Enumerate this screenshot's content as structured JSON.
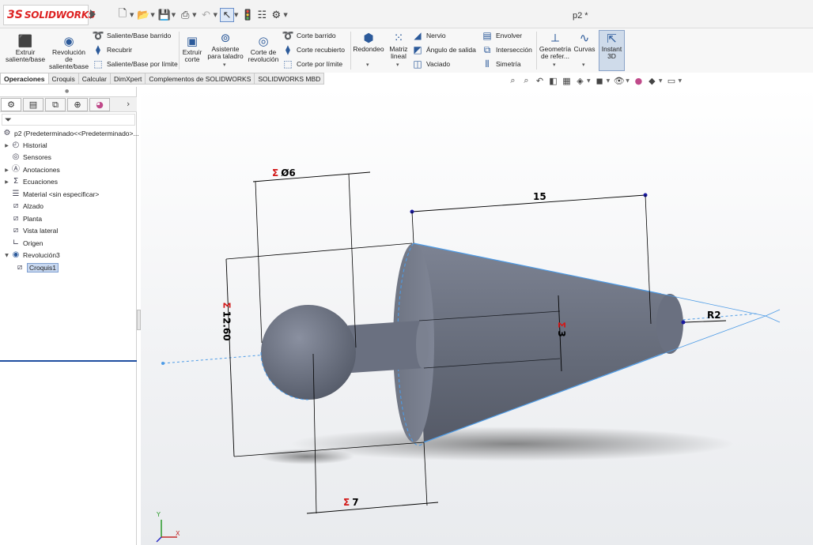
{
  "app": {
    "logo_mark": "3S",
    "logo_text": "SOLIDWORKS",
    "document_title": "p2 *"
  },
  "ribbon": {
    "extrude_boss": "Extruir saliente/base",
    "revolve_boss": "Revolución de saliente/base",
    "swept_boss": "Saliente/Base barrido",
    "loft": "Recubrir",
    "boundary_boss": "Saliente/Base por límite",
    "extrude_cut": "Extruir corte",
    "hole_wizard": "Asistente para taladro",
    "revolve_cut": "Corte de revolución",
    "swept_cut": "Corte barrido",
    "lofted_cut": "Corte recubierto",
    "boundary_cut": "Corte por límite",
    "fillet": "Redondeo",
    "linear_pattern": "Matriz lineal",
    "rib": "Nervio",
    "draft": "Ángulo de salida",
    "shell": "Vaciado",
    "wrap": "Envolver",
    "intersect": "Intersección",
    "mirror": "Simetría",
    "ref_geometry": "Geometría de refer...",
    "curves": "Curvas",
    "instant3d": "Instant 3D"
  },
  "tabs": [
    {
      "label": "Operaciones"
    },
    {
      "label": "Croquis"
    },
    {
      "label": "Calcular"
    },
    {
      "label": "DimXpert"
    },
    {
      "label": "Complementos de SOLIDWORKS"
    },
    {
      "label": "SOLIDWORKS MBD"
    }
  ],
  "feature_tree": {
    "root": "p2  (Predeterminado<<Predeterminado>...",
    "items": [
      {
        "label": "Historial"
      },
      {
        "label": "Sensores"
      },
      {
        "label": "Anotaciones"
      },
      {
        "label": "Ecuaciones"
      },
      {
        "label": "Material <sin especificar>"
      },
      {
        "label": "Alzado"
      },
      {
        "label": "Planta"
      },
      {
        "label": "Vista lateral"
      },
      {
        "label": "Origen"
      },
      {
        "label": "Revolución3"
      },
      {
        "label": "Croquis1"
      }
    ]
  },
  "dimensions": {
    "sigma": "Σ",
    "diameter": "Ø6",
    "length_15": "15",
    "height": "12.60",
    "width_3": "3",
    "radius": "R2",
    "length_7": "7"
  },
  "triad": {
    "y": "Y",
    "x": "X"
  },
  "colors": {
    "accent": "#1f4fa0",
    "dimension_sigma": "#d21818",
    "model_gray": "#6f7584",
    "sketch_blue": "#4d9be6"
  }
}
